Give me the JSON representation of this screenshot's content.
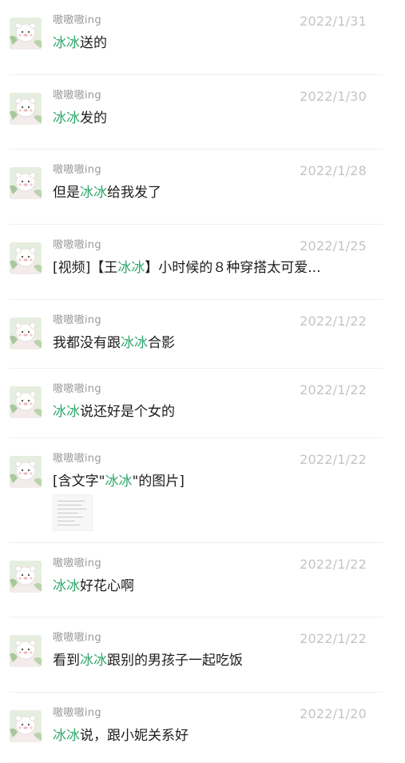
{
  "colors": {
    "keyword": "#2fa86a",
    "date": "#c4c4c4",
    "name": "#9a9a9a"
  },
  "rows": [
    {
      "name": "嗷嗷嗷ing",
      "date": "2022/1/31",
      "segments": [
        {
          "t": "冰冰",
          "hl": true
        },
        {
          "t": "送的"
        }
      ]
    },
    {
      "name": "嗷嗷嗷ing",
      "date": "2022/1/30",
      "segments": [
        {
          "t": "冰冰",
          "hl": true
        },
        {
          "t": "发的"
        }
      ]
    },
    {
      "name": "嗷嗷嗷ing",
      "date": "2022/1/28",
      "segments": [
        {
          "t": "但是"
        },
        {
          "t": "冰冰",
          "hl": true
        },
        {
          "t": "给我发了"
        }
      ]
    },
    {
      "name": "嗷嗷嗷ing",
      "date": "2022/1/25",
      "segments": [
        {
          "t": "[视频]【王"
        },
        {
          "t": "冰冰",
          "hl": true
        },
        {
          "t": "】小时候的８种穿搭太可爱..."
        }
      ]
    },
    {
      "name": "嗷嗷嗷ing",
      "date": "2022/1/22",
      "segments": [
        {
          "t": "我都没有跟"
        },
        {
          "t": "冰冰",
          "hl": true
        },
        {
          "t": "合影"
        }
      ]
    },
    {
      "name": "嗷嗷嗷ing",
      "date": "2022/1/22",
      "segments": [
        {
          "t": "冰冰",
          "hl": true
        },
        {
          "t": "说还好是个女的"
        }
      ]
    },
    {
      "name": "嗷嗷嗷ing",
      "date": "2022/1/22",
      "segments": [
        {
          "t": "[含文字\""
        },
        {
          "t": "冰冰",
          "hl": true
        },
        {
          "t": "\"的图片]"
        }
      ],
      "has_image": true
    },
    {
      "name": "嗷嗷嗷ing",
      "date": "2022/1/22",
      "segments": [
        {
          "t": "冰冰",
          "hl": true
        },
        {
          "t": "好花心啊"
        }
      ]
    },
    {
      "name": "嗷嗷嗷ing",
      "date": "2022/1/22",
      "segments": [
        {
          "t": "看到"
        },
        {
          "t": "冰冰",
          "hl": true
        },
        {
          "t": "跟别的男孩子一起吃饭"
        }
      ]
    },
    {
      "name": "嗷嗷嗷ing",
      "date": "2022/1/20",
      "segments": [
        {
          "t": "冰冰",
          "hl": true
        },
        {
          "t": "说，跟小妮关系好"
        }
      ]
    }
  ]
}
